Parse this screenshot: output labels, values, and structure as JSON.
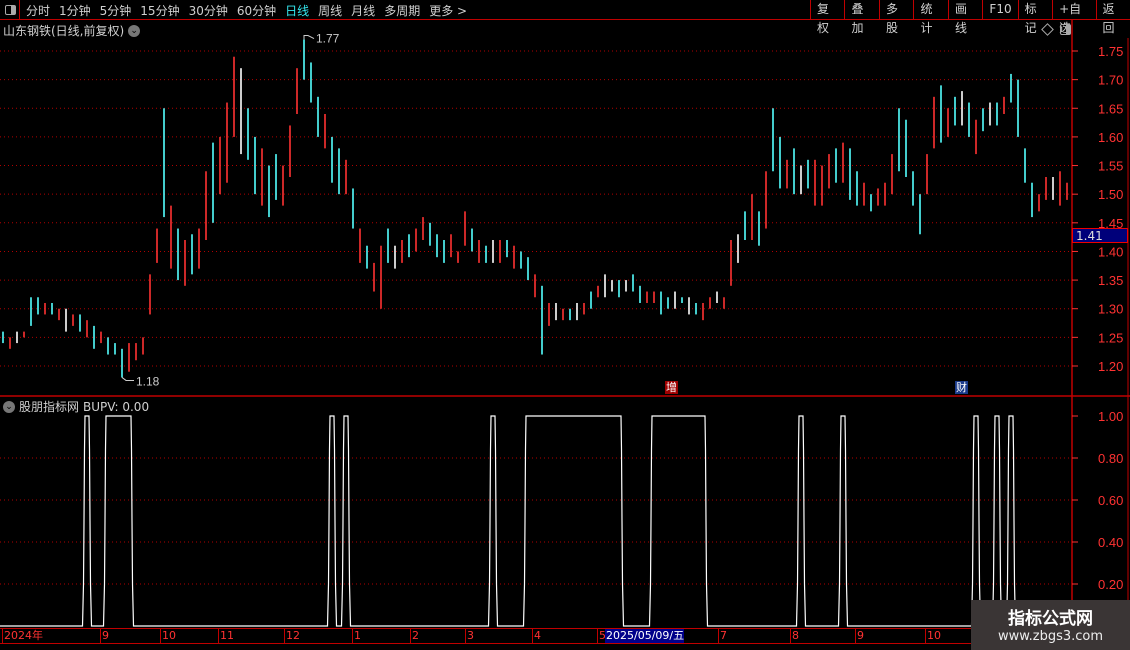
{
  "toolbar": {
    "periods": [
      "分时",
      "1分钟",
      "5分钟",
      "15分钟",
      "30分钟",
      "60分钟",
      "日线",
      "周线",
      "月线",
      "多周期",
      "更多 >"
    ],
    "active_period": "日线",
    "buttons": [
      "复权",
      "叠加",
      "多股",
      "统计",
      "画线",
      "F10",
      "标记",
      "+自选",
      "返回"
    ]
  },
  "title": "山东钢铁(日线,前复权)",
  "indicator": {
    "name": "股朋指标网",
    "readout": "BUPV: 0.00"
  },
  "current_price": "1.41",
  "annotations": {
    "high_label": "1.77",
    "low_label": "1.18",
    "marker_zeng": "增",
    "marker_cai": "财"
  },
  "date_axis": [
    "2024年",
    "9",
    "10",
    "11",
    "12",
    "1",
    "2",
    "3",
    "4",
    "5",
    "7",
    "8",
    "9",
    "10"
  ],
  "date_highlight": "2025/05/09/五",
  "watermark": {
    "title": "指标公式网",
    "url": "www.zbgs3.com"
  },
  "colors": {
    "up": "#ff3232",
    "down": "#54ffff",
    "flat": "#ffffff",
    "grid": "#b00000",
    "axis": "#ff3232"
  },
  "chart_data": [
    {
      "type": "candlestick",
      "ylim": [
        1.16,
        1.8
      ],
      "yticks": [
        1.2,
        1.25,
        1.3,
        1.35,
        1.4,
        1.45,
        1.5,
        1.55,
        1.6,
        1.65,
        1.7,
        1.75
      ],
      "grid": true,
      "bars_low_high_dir": [
        [
          1.24,
          1.26,
          "d"
        ],
        [
          1.23,
          1.25,
          "u"
        ],
        [
          1.24,
          1.26,
          "f"
        ],
        [
          1.25,
          1.26,
          "u"
        ],
        [
          1.27,
          1.32,
          "d"
        ],
        [
          1.29,
          1.32,
          "d"
        ],
        [
          1.29,
          1.31,
          "u"
        ],
        [
          1.29,
          1.31,
          "d"
        ],
        [
          1.28,
          1.3,
          "u"
        ],
        [
          1.26,
          1.3,
          "f"
        ],
        [
          1.27,
          1.29,
          "u"
        ],
        [
          1.26,
          1.29,
          "d"
        ],
        [
          1.25,
          1.28,
          "u"
        ],
        [
          1.23,
          1.27,
          "d"
        ],
        [
          1.24,
          1.26,
          "u"
        ],
        [
          1.22,
          1.25,
          "d"
        ],
        [
          1.22,
          1.24,
          "d"
        ],
        [
          1.18,
          1.23,
          "d"
        ],
        [
          1.19,
          1.24,
          "u"
        ],
        [
          1.21,
          1.24,
          "u"
        ],
        [
          1.22,
          1.25,
          "u"
        ],
        [
          1.29,
          1.36,
          "u"
        ],
        [
          1.38,
          1.44,
          "u"
        ],
        [
          1.46,
          1.65,
          "d"
        ],
        [
          1.37,
          1.48,
          "u"
        ],
        [
          1.35,
          1.44,
          "d"
        ],
        [
          1.34,
          1.42,
          "u"
        ],
        [
          1.36,
          1.43,
          "d"
        ],
        [
          1.37,
          1.44,
          "u"
        ],
        [
          1.42,
          1.54,
          "u"
        ],
        [
          1.45,
          1.59,
          "d"
        ],
        [
          1.5,
          1.6,
          "u"
        ],
        [
          1.52,
          1.66,
          "u"
        ],
        [
          1.6,
          1.74,
          "u"
        ],
        [
          1.57,
          1.72,
          "f"
        ],
        [
          1.56,
          1.65,
          "d"
        ],
        [
          1.5,
          1.6,
          "d"
        ],
        [
          1.48,
          1.58,
          "u"
        ],
        [
          1.46,
          1.55,
          "d"
        ],
        [
          1.49,
          1.57,
          "d"
        ],
        [
          1.48,
          1.55,
          "u"
        ],
        [
          1.53,
          1.62,
          "u"
        ],
        [
          1.64,
          1.72,
          "u"
        ],
        [
          1.7,
          1.77,
          "d"
        ],
        [
          1.66,
          1.73,
          "d"
        ],
        [
          1.6,
          1.67,
          "d"
        ],
        [
          1.58,
          1.64,
          "u"
        ],
        [
          1.52,
          1.6,
          "d"
        ],
        [
          1.5,
          1.58,
          "d"
        ],
        [
          1.5,
          1.56,
          "u"
        ],
        [
          1.44,
          1.51,
          "d"
        ],
        [
          1.38,
          1.44,
          "u"
        ],
        [
          1.37,
          1.41,
          "d"
        ],
        [
          1.33,
          1.38,
          "u"
        ],
        [
          1.3,
          1.41,
          "u"
        ],
        [
          1.38,
          1.44,
          "d"
        ],
        [
          1.37,
          1.41,
          "f"
        ],
        [
          1.38,
          1.42,
          "u"
        ],
        [
          1.39,
          1.43,
          "d"
        ],
        [
          1.4,
          1.44,
          "u"
        ],
        [
          1.42,
          1.46,
          "u"
        ],
        [
          1.41,
          1.45,
          "d"
        ],
        [
          1.39,
          1.43,
          "d"
        ],
        [
          1.38,
          1.42,
          "d"
        ],
        [
          1.39,
          1.43,
          "u"
        ],
        [
          1.38,
          1.4,
          "u"
        ],
        [
          1.41,
          1.47,
          "u"
        ],
        [
          1.4,
          1.44,
          "d"
        ],
        [
          1.38,
          1.42,
          "u"
        ],
        [
          1.38,
          1.41,
          "d"
        ],
        [
          1.38,
          1.42,
          "f"
        ],
        [
          1.38,
          1.42,
          "u"
        ],
        [
          1.39,
          1.42,
          "d"
        ],
        [
          1.37,
          1.41,
          "u"
        ],
        [
          1.37,
          1.4,
          "d"
        ],
        [
          1.35,
          1.39,
          "d"
        ],
        [
          1.32,
          1.36,
          "u"
        ],
        [
          1.22,
          1.34,
          "d"
        ],
        [
          1.27,
          1.31,
          "u"
        ],
        [
          1.28,
          1.31,
          "f"
        ],
        [
          1.28,
          1.3,
          "u"
        ],
        [
          1.28,
          1.3,
          "d"
        ],
        [
          1.28,
          1.31,
          "f"
        ],
        [
          1.29,
          1.31,
          "u"
        ],
        [
          1.3,
          1.33,
          "d"
        ],
        [
          1.32,
          1.34,
          "u"
        ],
        [
          1.32,
          1.36,
          "f"
        ],
        [
          1.33,
          1.35,
          "f"
        ],
        [
          1.32,
          1.35,
          "d"
        ],
        [
          1.33,
          1.35,
          "f"
        ],
        [
          1.33,
          1.36,
          "d"
        ],
        [
          1.31,
          1.34,
          "d"
        ],
        [
          1.31,
          1.33,
          "u"
        ],
        [
          1.31,
          1.33,
          "u"
        ],
        [
          1.29,
          1.33,
          "d"
        ],
        [
          1.3,
          1.32,
          "d"
        ],
        [
          1.3,
          1.33,
          "f"
        ],
        [
          1.31,
          1.32,
          "d"
        ],
        [
          1.29,
          1.32,
          "f"
        ],
        [
          1.29,
          1.31,
          "d"
        ],
        [
          1.28,
          1.31,
          "u"
        ],
        [
          1.3,
          1.32,
          "u"
        ],
        [
          1.31,
          1.33,
          "f"
        ],
        [
          1.3,
          1.32,
          "u"
        ],
        [
          1.34,
          1.42,
          "u"
        ],
        [
          1.38,
          1.43,
          "f"
        ],
        [
          1.42,
          1.47,
          "d"
        ],
        [
          1.42,
          1.5,
          "u"
        ],
        [
          1.41,
          1.47,
          "d"
        ],
        [
          1.44,
          1.54,
          "u"
        ],
        [
          1.54,
          1.65,
          "d"
        ],
        [
          1.51,
          1.6,
          "d"
        ],
        [
          1.51,
          1.56,
          "u"
        ],
        [
          1.5,
          1.58,
          "d"
        ],
        [
          1.5,
          1.55,
          "f"
        ],
        [
          1.51,
          1.56,
          "d"
        ],
        [
          1.48,
          1.56,
          "u"
        ],
        [
          1.48,
          1.55,
          "u"
        ],
        [
          1.51,
          1.57,
          "u"
        ],
        [
          1.52,
          1.58,
          "d"
        ],
        [
          1.52,
          1.59,
          "u"
        ],
        [
          1.49,
          1.58,
          "d"
        ],
        [
          1.48,
          1.54,
          "d"
        ],
        [
          1.48,
          1.52,
          "u"
        ],
        [
          1.47,
          1.5,
          "d"
        ],
        [
          1.48,
          1.51,
          "u"
        ],
        [
          1.48,
          1.52,
          "u"
        ],
        [
          1.5,
          1.57,
          "u"
        ],
        [
          1.54,
          1.65,
          "d"
        ],
        [
          1.53,
          1.63,
          "d"
        ],
        [
          1.48,
          1.54,
          "d"
        ],
        [
          1.43,
          1.5,
          "d"
        ],
        [
          1.5,
          1.57,
          "u"
        ],
        [
          1.58,
          1.67,
          "u"
        ],
        [
          1.59,
          1.69,
          "d"
        ],
        [
          1.6,
          1.65,
          "u"
        ],
        [
          1.62,
          1.67,
          "d"
        ],
        [
          1.62,
          1.68,
          "f"
        ],
        [
          1.6,
          1.66,
          "d"
        ],
        [
          1.57,
          1.63,
          "u"
        ],
        [
          1.61,
          1.65,
          "d"
        ],
        [
          1.62,
          1.66,
          "f"
        ],
        [
          1.62,
          1.66,
          "d"
        ],
        [
          1.64,
          1.67,
          "u"
        ],
        [
          1.66,
          1.71,
          "d"
        ],
        [
          1.6,
          1.7,
          "d"
        ],
        [
          1.52,
          1.58,
          "d"
        ],
        [
          1.46,
          1.52,
          "d"
        ],
        [
          1.47,
          1.5,
          "u"
        ],
        [
          1.49,
          1.53,
          "u"
        ],
        [
          1.49,
          1.53,
          "f"
        ],
        [
          1.48,
          1.54,
          "u"
        ],
        [
          1.49,
          1.52,
          "u"
        ]
      ]
    },
    {
      "type": "line",
      "series_name": "BUPV",
      "ylim": [
        0,
        1.05
      ],
      "yticks": [
        "1.00",
        "0.80",
        "0.60",
        "0.40",
        "0.20"
      ],
      "one_at_bars": [
        12,
        15,
        16,
        17,
        18,
        47,
        49,
        70,
        75,
        76,
        77,
        78,
        79,
        80,
        81,
        82,
        83,
        84,
        85,
        86,
        87,
        88,
        93,
        94,
        95,
        96,
        97,
        98,
        99,
        100,
        114,
        120,
        139,
        142,
        144
      ]
    }
  ]
}
